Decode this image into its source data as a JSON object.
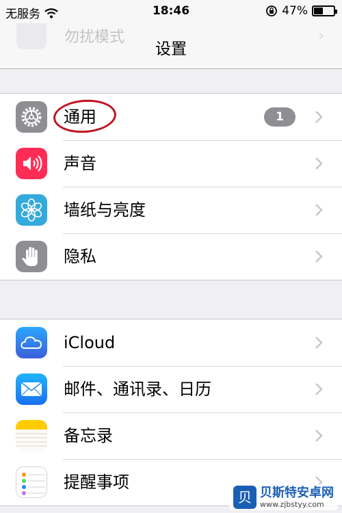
{
  "status_bar": {
    "carrier": "无服务",
    "time": "18:46",
    "battery_percent": "47%",
    "battery_level": 0.47
  },
  "nav": {
    "title": "设置",
    "ghost_item_label": "勿扰模式"
  },
  "groups": [
    {
      "rows": [
        {
          "label": "通用",
          "icon": "gear-icon",
          "icon_color": "#8e8e93",
          "badge": "1",
          "annotated": true
        },
        {
          "label": "声音",
          "icon": "speaker-icon",
          "icon_color": "#ff2d55"
        },
        {
          "label": "墙纸与亮度",
          "icon": "flower-icon",
          "icon_color": "#34aadc"
        },
        {
          "label": "隐私",
          "icon": "hand-icon",
          "icon_color": "#8e8e93"
        }
      ]
    },
    {
      "rows": [
        {
          "label": "iCloud",
          "icon": "cloud-icon",
          "icon_color": "#1f86f2"
        },
        {
          "label": "邮件、通讯录、日历",
          "icon": "mail-icon",
          "icon_color": "#1a8df8"
        },
        {
          "label": "备忘录",
          "icon": "notes-icon",
          "icon_color": "#ffcc00"
        },
        {
          "label": "提醒事项",
          "icon": "reminders-icon",
          "icon_color": "#ffffff"
        }
      ]
    }
  ],
  "watermark": {
    "name": "贝斯特安卓网",
    "url": "www.zjbstyy.com",
    "logo_char": "贝"
  }
}
